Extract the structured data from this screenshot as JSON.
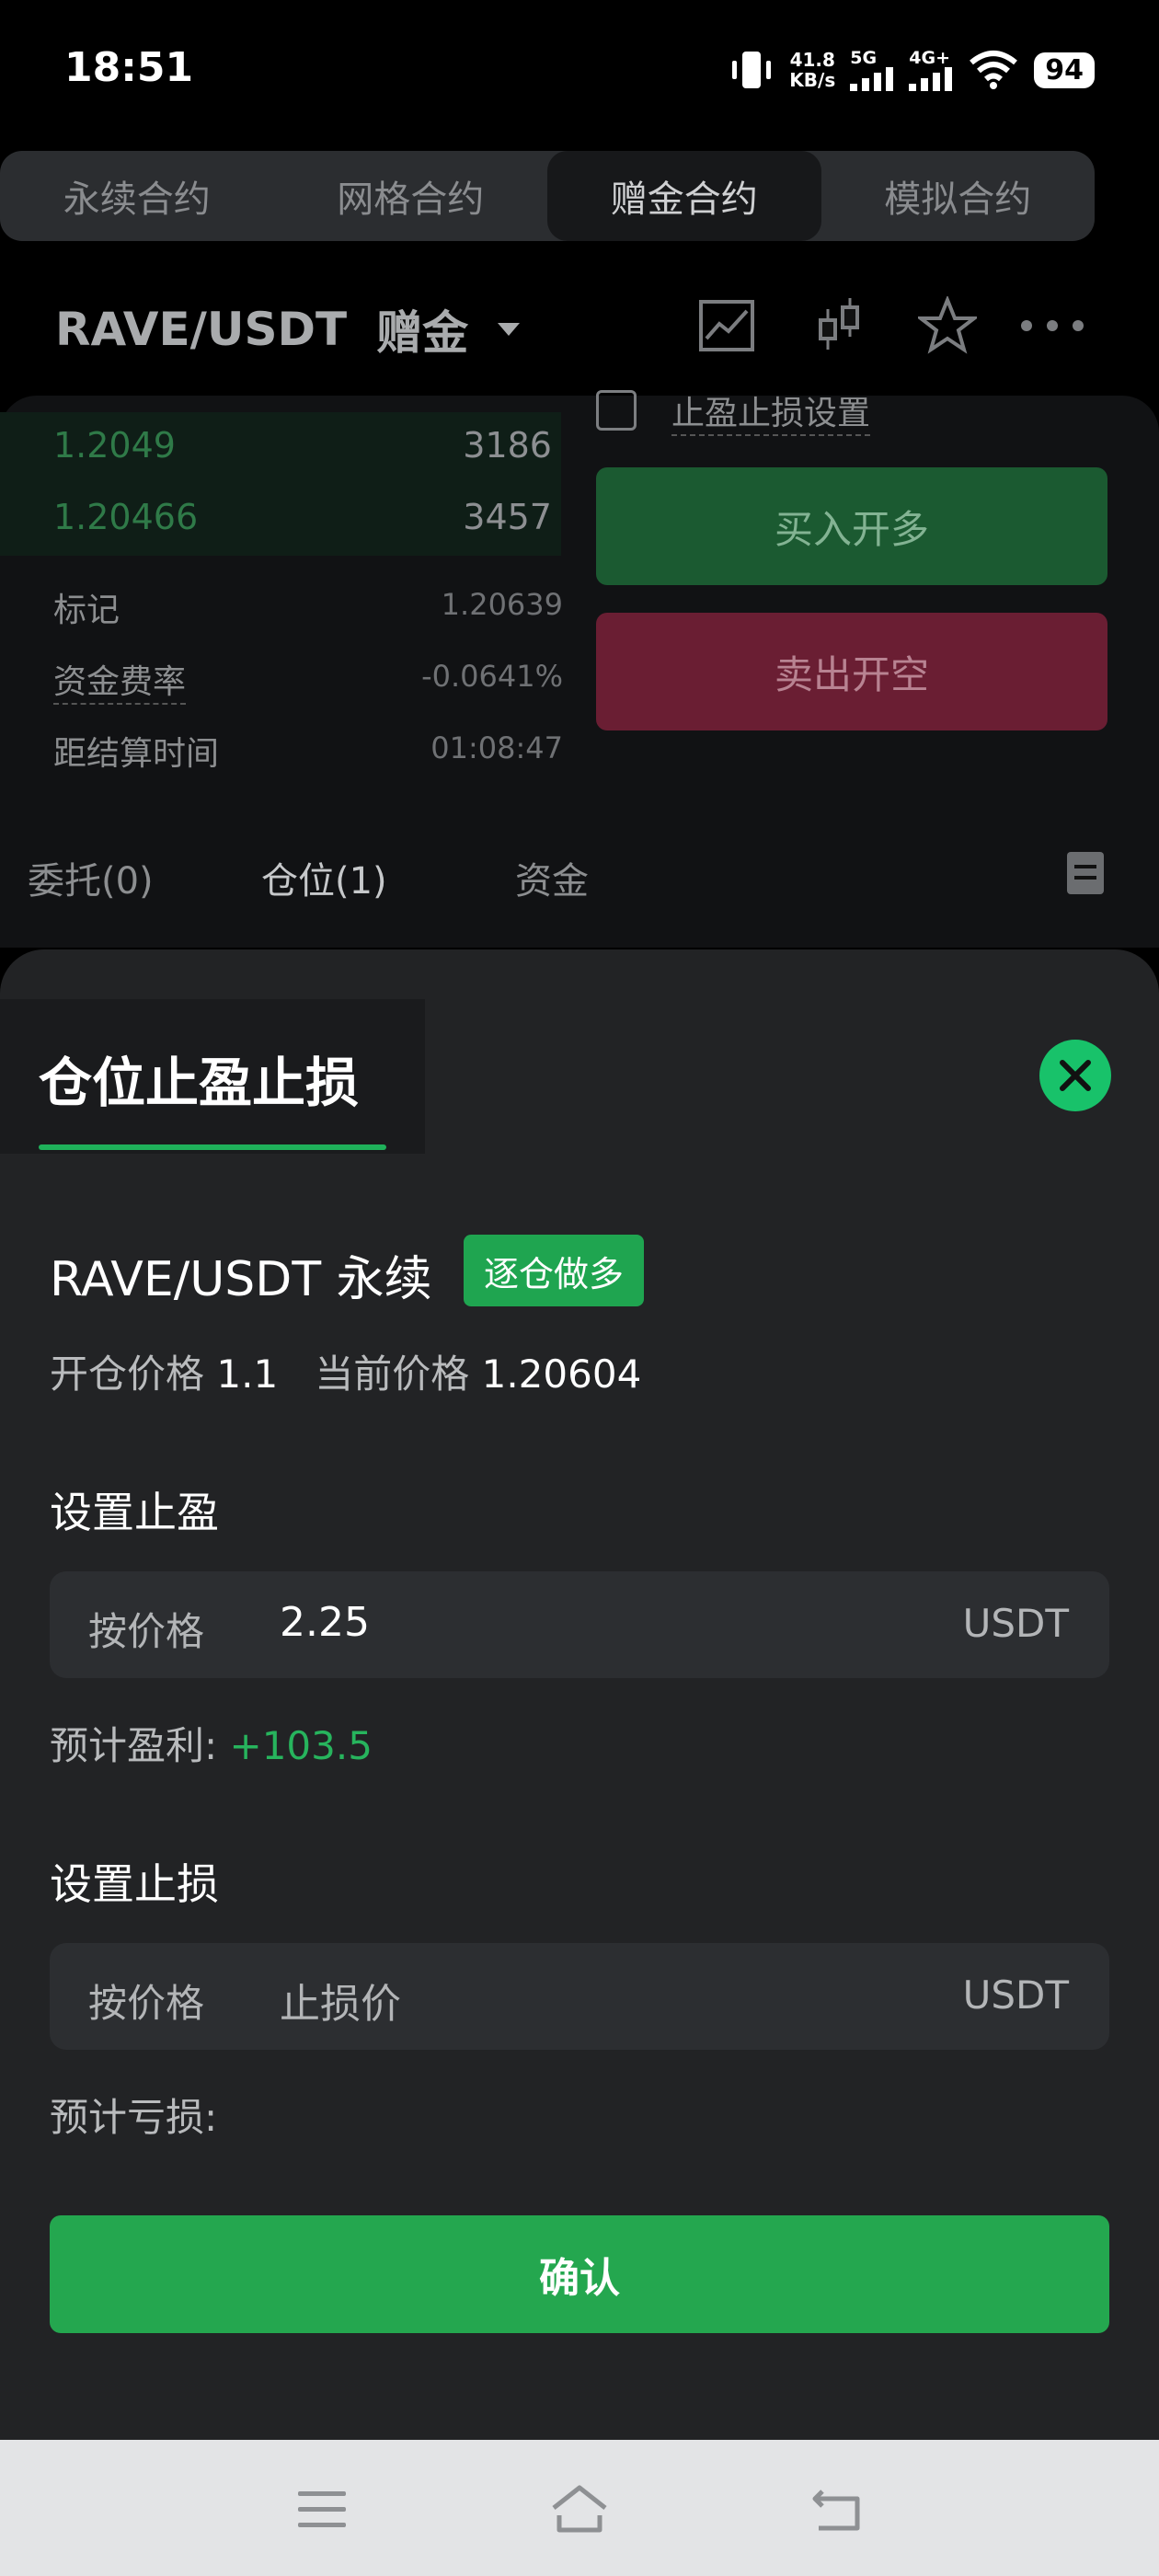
{
  "status_bar": {
    "time": "18:51",
    "speed_value": "41.8",
    "speed_unit": "KB/s",
    "net1": "5G",
    "net2": "4G+",
    "battery": "94"
  },
  "contract_tabs": [
    {
      "label": "永续合约"
    },
    {
      "label": "网格合约"
    },
    {
      "label": "赠金合约",
      "active": true
    },
    {
      "label": "模拟合约"
    }
  ],
  "pair": {
    "symbol": "RAVE/USDT",
    "tag": "赠金"
  },
  "order_book": [
    {
      "price": "1.2049",
      "qty": "3186"
    },
    {
      "price": "1.20466",
      "qty": "3457"
    }
  ],
  "stats": [
    {
      "label": "标记",
      "value": "1.20639"
    },
    {
      "label": "资金费率",
      "value": "-0.0641%"
    },
    {
      "label": "距结算时间",
      "value": "01:08:47"
    }
  ],
  "trade": {
    "tpsl_setting": "止盈止损设置",
    "buy_label": "买入开多",
    "sell_label": "卖出开空"
  },
  "sub_tabs": [
    {
      "label": "委托(0)"
    },
    {
      "label": "仓位(1)"
    },
    {
      "label": "资金"
    }
  ],
  "modal": {
    "title": "仓位止盈止损",
    "position_name": "RAVE/USDT 永续",
    "position_badge": "逐仓做多",
    "open_price_label": "开仓价格",
    "open_price": "1.1",
    "current_price_label": "当前价格",
    "current_price": "1.20604",
    "tp": {
      "title": "设置止盈",
      "mode": "按价格",
      "value": "2.25",
      "unit": "USDT",
      "est_label": "预计盈利:",
      "est_value": "+103.5"
    },
    "sl": {
      "title": "设置止损",
      "mode": "按价格",
      "placeholder": "止损价",
      "unit": "USDT",
      "est_label": "预计亏损:"
    },
    "confirm": "确认"
  },
  "colors": {
    "accent_green": "#24a74f",
    "profit_green": "#27b45d",
    "sheet_bg": "#222325"
  }
}
